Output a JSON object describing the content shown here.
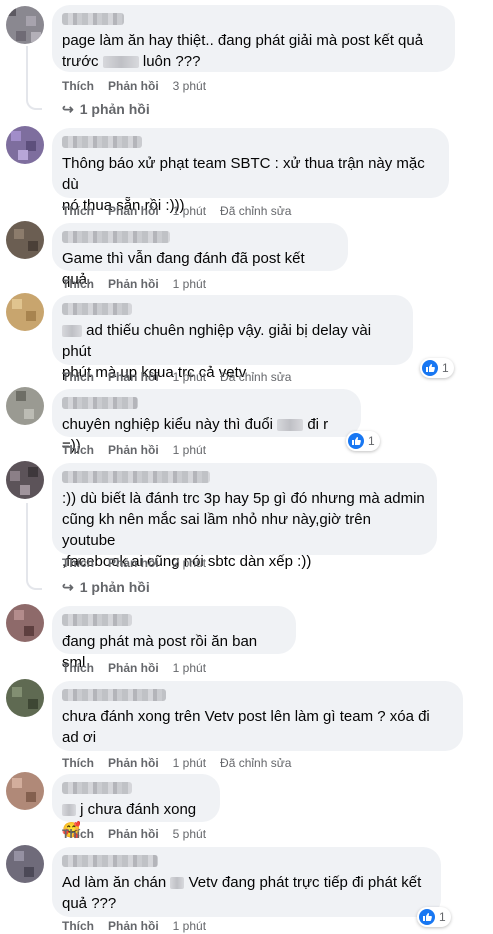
{
  "ui": {
    "like": "Thích",
    "reply": "Phản hồi",
    "edited": "Đã chỉnh sửa"
  },
  "comments": [
    {
      "id": "c1",
      "line1": "page làm ăn hay thiệt.. đang phát giải mà post kết quả",
      "line2_pre": "trước ",
      "line2_post": " luôn ???",
      "time": "3 phút",
      "replies": "1 phản hồi"
    },
    {
      "id": "c2",
      "line1": "Thông báo xử phạt team SBTC : xử thua trận này mặc dù",
      "line2": "nó thua sẵn rồi :)))",
      "time": "1 phút",
      "edited": true
    },
    {
      "id": "c3",
      "line1": "Game thì vẫn đang đánh đã post kết quả.",
      "time": "1 phút"
    },
    {
      "id": "c4",
      "line1_post": " ad thiếu chuên nghiệp vậy. giải bị delay vài phút",
      "line2": "phút mà up kqua trc cả vetv",
      "time": "1 phút",
      "edited": true,
      "reaction": "1"
    },
    {
      "id": "c5",
      "line1_pre": "chuyên nghiệp kiểu này thì đuổi ",
      "line1_post": " đi r =))",
      "time": "1 phút",
      "reaction": "1"
    },
    {
      "id": "c6",
      "line1": ":)) dù biết là đánh trc 3p hay 5p gì đó nhưng mà admin",
      "line2": "cũng kh nên mắc sai lầm nhỏ như này,giờ trên youtube",
      "line3": ",facebook ai cũng nói sbtc dàn xếp :))",
      "time": "2 phút",
      "replies": "1 phản hồi"
    },
    {
      "id": "c7",
      "line1": "đang phát mà post rồi ăn ban sml",
      "time": "1 phút"
    },
    {
      "id": "c8",
      "line1": "chưa đánh xong trên Vetv post lên làm gì team ? xóa đi",
      "line2": "ad ơi",
      "time": "1 phút",
      "edited": true
    },
    {
      "id": "c9",
      "line1_post": " j chưa đánh xong🥰",
      "time": "5 phút"
    },
    {
      "id": "c10",
      "line1_pre": "Ad làm ăn chán ",
      "line1_post": " Vetv đang phát trực tiếp đi phát kết",
      "line2": "quả ???",
      "time": "1 phút",
      "reaction": "1"
    }
  ]
}
